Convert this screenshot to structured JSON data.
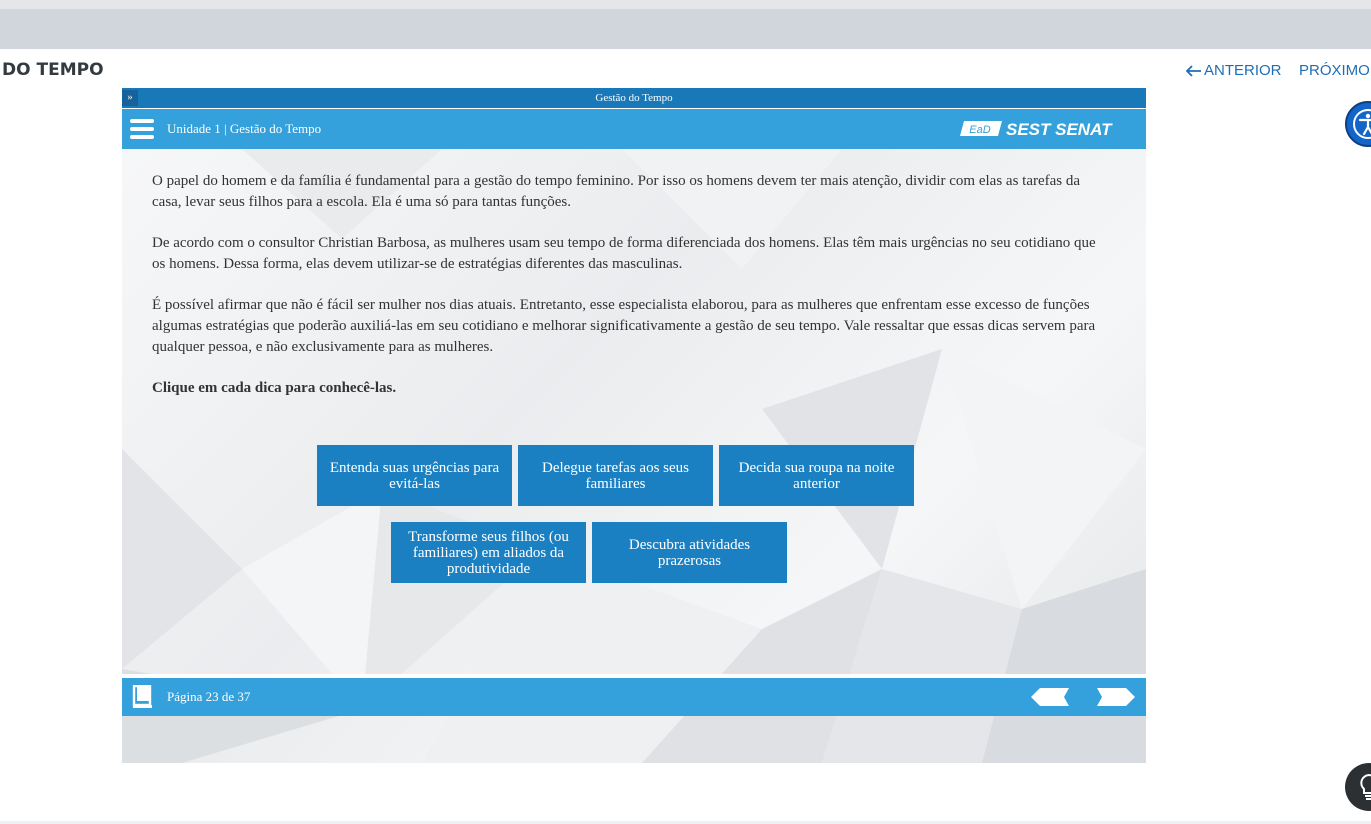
{
  "page": {
    "course_title": "DO TEMPO",
    "nav_prev_label": "ANTERIOR",
    "nav_next_label": "PRÓXIMO"
  },
  "player": {
    "title": "Gestão do Tempo",
    "unit_label": "Unidade 1 | Gestão do Tempo",
    "logo_ead": "EaD",
    "logo_text": "SEST SENAT",
    "paragraphs": [
      "O papel do homem e da família é fundamental para a gestão do tempo feminino. Por isso os homens devem ter mais atenção, dividir com elas as tarefas da casa, levar seus filhos para a escola. Ela é uma só para tantas funções.",
      "De acordo com o consultor Christian Barbosa, as mulheres usam seu tempo de forma diferenciada dos homens. Elas têm mais urgências no seu cotidiano que os homens. Dessa forma, elas devem utilizar-se de estratégias diferentes das masculinas.",
      "É possível afirmar que não é fácil ser mulher nos dias atuais. Entretanto, esse especialista elaborou, para as mulheres que enfrentam esse excesso de funções algumas estratégias que poderão auxiliá-las em seu cotidiano e melhorar significativamente a gestão de seu tempo. Vale ressaltar que essas dicas servem para qualquer pessoa, e não exclusivamente para as mulheres."
    ],
    "instruction": "Clique em cada dica para conhecê-las.",
    "tips": [
      "Entenda suas urgências para evitá-las",
      "Delegue tarefas aos seus familiares",
      "Decida sua roupa na noite anterior",
      "Transforme seus filhos (ou familiares) em aliados da produtividade",
      "Descubra atividades prazerosas"
    ],
    "page_label": "Página 23 de 37"
  },
  "icons": [
    "expand-icon",
    "menu-icon",
    "book-icon",
    "arrow-left-icon",
    "arrow-right-icon",
    "accessibility-icon",
    "lightbulb-icon"
  ],
  "colors": {
    "header_blue": "#34a1dc",
    "title_blue": "#1979b8",
    "button_blue": "#1a80c2",
    "link_blue": "#1f6db5"
  }
}
